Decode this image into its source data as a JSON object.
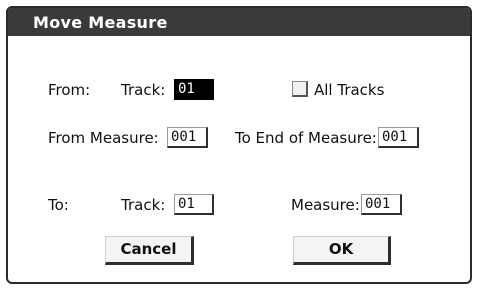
{
  "dialog": {
    "title": "Move Measure",
    "from_label": "From:",
    "from_track_label": "Track:",
    "from_track_value": "01",
    "all_tracks_label": "All Tracks",
    "all_tracks_checked": false,
    "from_measure_label": "From Measure:",
    "from_measure_value": "001",
    "to_end_label": "To End of Measure:",
    "to_end_value": "001",
    "to_label": "To:",
    "to_track_label": "Track:",
    "to_track_value": "01",
    "to_measure_label": "Measure:",
    "to_measure_value": "001",
    "cancel_label": "Cancel",
    "ok_label": "OK"
  }
}
